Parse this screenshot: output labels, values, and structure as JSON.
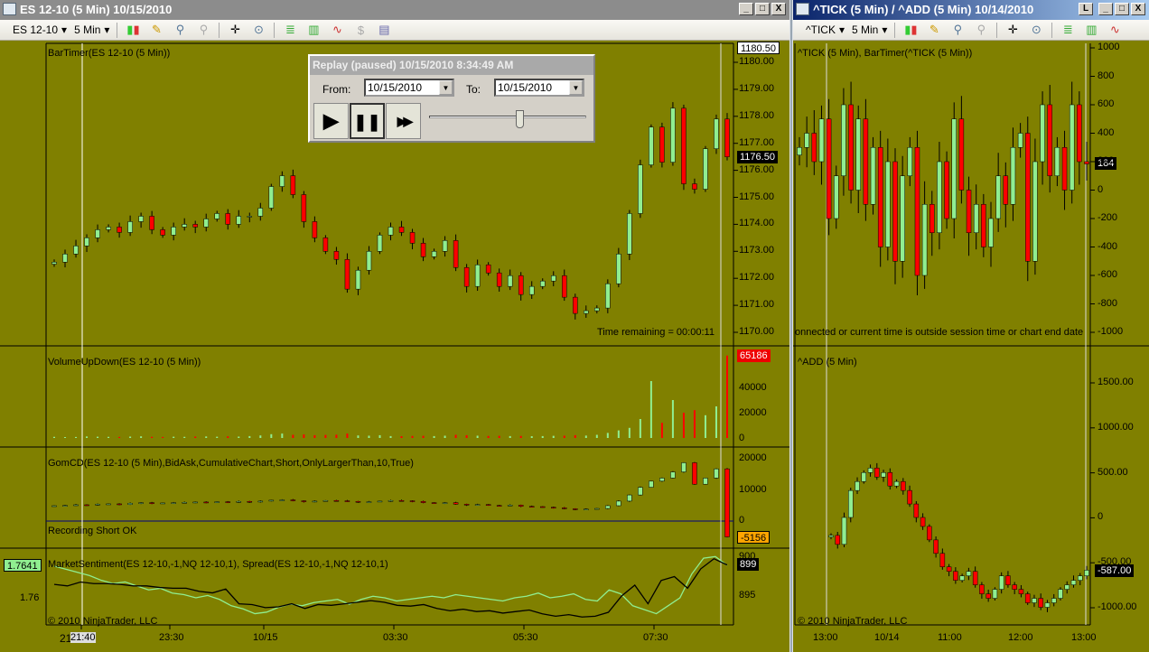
{
  "left_window": {
    "title": "ES 12-10 (5 Min)  10/15/2010",
    "toolbar": {
      "instrument": "ES 12-10",
      "interval": "5 Min"
    },
    "window_buttons": [
      "_",
      "□",
      "X"
    ],
    "panels": {
      "price": {
        "label": "BarTimer(ES 12-10 (5 Min))",
        "axis": [
          "1180.00",
          "1179.00",
          "1178.00",
          "1177.00",
          "1176.00",
          "1175.00",
          "1174.00",
          "1173.00",
          "1172.00",
          "1171.00",
          "1170.00"
        ],
        "top_tag": "1180.50",
        "last_tag": "1176.50",
        "time_remaining": "Time remaining = 00:00:11"
      },
      "volume": {
        "label": "VolumeUpDown(ES 12-10 (5 Min))",
        "axis": [
          "40000",
          "20000",
          "0"
        ],
        "last_tag": "65186"
      },
      "gomcd": {
        "label": "GomCD(ES 12-10 (5 Min),BidAsk,CumulativeChart,Short,OnlyLargerThan,10,True)",
        "axis": [
          "20000",
          "10000",
          "0"
        ],
        "status": "Recording Short OK",
        "last_tag": "-5156"
      },
      "sentiment": {
        "label": "MarketSentiment(ES 12-10,-1,NQ 12-10,1), Spread(ES 12-10,-1,NQ 12-10,1)",
        "left_axis": "1.76",
        "left_tag": "1.7641",
        "right_axis": [
          "900",
          "895"
        ],
        "right_tag": "899",
        "copyright": "© 2010 NinjaTrader, LLC"
      }
    },
    "time_axis": [
      "21:40",
      "23:30",
      "10/15",
      "03:30",
      "05:30",
      "07:30"
    ],
    "time_axis_prefix": "21"
  },
  "replay": {
    "title": "Replay (paused) 10/15/2010 8:34:49 AM",
    "from_label": "From:",
    "from_value": "10/15/2010",
    "to_label": "To:",
    "to_value": "10/15/2010",
    "play": "▶",
    "pause": "❚❚",
    "fast_forward": "▶▶",
    "slider_position": 0.55
  },
  "right_window": {
    "title": "^TICK (5 Min) / ^ADD (5 Min)  10/14/2010",
    "toolbar": {
      "instrument": "^TICK",
      "interval": "5 Min"
    },
    "window_buttons": [
      "L",
      "_",
      "□",
      "X"
    ],
    "tick": {
      "label": "^TICK (5 Min), BarTimer(^TICK (5 Min))",
      "axis": [
        "1000",
        "800",
        "600",
        "400",
        "200",
        "0",
        "-200",
        "-400",
        "-600",
        "-800",
        "-1000"
      ],
      "last_tag": "184",
      "message": "onnected or current time is outside session time or chart end date"
    },
    "add": {
      "label": "^ADD (5 Min)",
      "axis": [
        "1500.00",
        "1000.00",
        "500.00",
        "0",
        "-500.00",
        "-1000.00"
      ],
      "last_tag": "-587.00",
      "copyright": "© 2010 NinjaTrader, LLC"
    },
    "time_axis": [
      "13:00",
      "10/14",
      "11:00",
      "12:00",
      "13:00"
    ]
  },
  "colors": {
    "background": "#808000",
    "up": "#90ee90",
    "down": "#ff0000",
    "wick": "#000000"
  },
  "chart_data": [
    {
      "type": "candlestick",
      "name": "ES 12-10 (5 Min)",
      "ylim": [
        1170,
        1180.5
      ],
      "close": [
        1172.6,
        1172.9,
        1173.2,
        1173.5,
        1173.8,
        1173.9,
        1173.7,
        1174.1,
        1174.3,
        1173.8,
        1173.6,
        1173.9,
        1174.0,
        1173.9,
        1174.2,
        1174.4,
        1174.0,
        1174.3,
        1174.3,
        1174.6,
        1175.4,
        1175.8,
        1175.1,
        1174.1,
        1173.5,
        1173.0,
        1172.7,
        1171.6,
        1172.3,
        1173.0,
        1173.6,
        1173.9,
        1173.7,
        1173.3,
        1172.8,
        1173.0,
        1173.4,
        1172.4,
        1171.7,
        1172.5,
        1172.2,
        1171.7,
        1172.1,
        1171.4,
        1171.7,
        1171.9,
        1172.1,
        1171.3,
        1170.7,
        1170.8,
        1170.9,
        1171.8,
        1172.9,
        1174.4,
        1176.2,
        1177.6,
        1176.3,
        1178.3,
        1175.5,
        1175.3,
        1176.8,
        1177.9,
        1176.5
      ]
    },
    {
      "type": "bar",
      "name": "VolumeUpDown",
      "ylim": [
        0,
        65186
      ],
      "values": [
        900,
        700,
        800,
        1200,
        1000,
        900,
        800,
        1100,
        1300,
        900,
        800,
        1000,
        900,
        1100,
        1200,
        1000,
        1300,
        1100,
        1500,
        2000,
        3000,
        3500,
        2500,
        2800,
        2200,
        2400,
        2600,
        3500,
        2000,
        1800,
        2200,
        1500,
        1400,
        1600,
        1700,
        1500,
        1800,
        2500,
        2200,
        1800,
        1600,
        1700,
        1500,
        1600,
        1400,
        1500,
        1700,
        1800,
        2200,
        1900,
        2500,
        4000,
        6000,
        8000,
        15000,
        45000,
        12000,
        30000,
        20000,
        22000,
        18000,
        25000,
        65186
      ]
    },
    {
      "type": "candlestick",
      "name": "GomCD",
      "ylim": [
        -7000,
        22000
      ],
      "close": [
        5000,
        5100,
        5300,
        5200,
        5500,
        5600,
        5400,
        5800,
        6000,
        5700,
        5900,
        6000,
        6100,
        6200,
        6000,
        6300,
        6100,
        6400,
        6200,
        6500,
        6800,
        6900,
        6600,
        6300,
        6500,
        6700,
        6600,
        6400,
        6200,
        6300,
        6500,
        6700,
        6600,
        6400,
        6000,
        5800,
        6000,
        5500,
        5200,
        5400,
        5100,
        5000,
        5200,
        4800,
        4700,
        4500,
        4300,
        4000,
        3800,
        3900,
        4100,
        5000,
        6500,
        8500,
        11000,
        13000,
        14000,
        16000,
        19000,
        12000,
        14000,
        17000,
        -5156
      ]
    },
    {
      "type": "line",
      "name": "MarketSentiment",
      "ylim": [
        1.7575,
        1.7655
      ],
      "values": [
        1.764,
        1.7636,
        1.7632,
        1.7628,
        1.7622,
        1.7618,
        1.762,
        1.7615,
        1.761,
        1.7612,
        1.7606,
        1.7604,
        1.76,
        1.7603,
        1.7598,
        1.759,
        1.7586,
        1.758,
        1.7582,
        1.7588,
        1.7592,
        1.759,
        1.7594,
        1.7596,
        1.7598,
        1.7592,
        1.7598,
        1.7602,
        1.76,
        1.7596,
        1.7598,
        1.76,
        1.7602,
        1.76,
        1.7604,
        1.7602,
        1.76,
        1.7598,
        1.7596,
        1.76,
        1.7602,
        1.7606,
        1.76,
        1.7602,
        1.7605,
        1.7598,
        1.7596,
        1.761,
        1.7605,
        1.759,
        1.7585,
        1.758,
        1.759,
        1.76,
        1.763,
        1.765,
        1.7652,
        1.7641
      ]
    },
    {
      "type": "line",
      "name": "Spread",
      "ylim": [
        891,
        900.5
      ],
      "values": [
        896.5,
        896.3,
        896.8,
        896.6,
        896.6,
        896.5,
        896.3,
        896.3,
        896.1,
        896.0,
        896.0,
        895.6,
        895.4,
        895.9,
        894.0,
        893.9,
        893.5,
        893.6,
        894.0,
        893.4,
        893.9,
        893.8,
        894.0,
        894.2,
        894.4,
        894.2,
        893.8,
        893.7,
        893.9,
        893.4,
        893.1,
        893.3,
        893.0,
        893.1,
        892.8,
        893.0,
        893.2,
        892.7,
        892.4,
        892.6,
        892.3,
        892.4,
        892.9,
        895.0,
        896.4,
        894.0,
        897.0,
        897.5,
        896.0,
        898.5,
        899.8,
        899.0
      ]
    },
    {
      "type": "candlestick",
      "name": "^TICK (5 Min)",
      "ylim": [
        -1000,
        1000
      ],
      "close": [
        300,
        400,
        200,
        500,
        -200,
        100,
        600,
        0,
        500,
        -100,
        300,
        -400,
        200,
        -500,
        100,
        300,
        -600,
        -100,
        -300,
        200,
        -200,
        500,
        0,
        -300,
        -100,
        -400,
        -200,
        100,
        -100,
        300,
        400,
        -500,
        200,
        600,
        100,
        300,
        0,
        600,
        200,
        184
      ]
    },
    {
      "type": "candlestick",
      "name": "^ADD (5 Min)",
      "ylim": [
        -1000,
        1500
      ],
      "close": [
        -200,
        -300,
        0,
        300,
        400,
        500,
        550,
        450,
        500,
        350,
        400,
        300,
        150,
        0,
        -100,
        -250,
        -400,
        -550,
        -600,
        -700,
        -650,
        -600,
        -750,
        -850,
        -900,
        -800,
        -650,
        -750,
        -800,
        -850,
        -950,
        -900,
        -1000,
        -950,
        -900,
        -800,
        -750,
        -700,
        -650,
        -587
      ]
    }
  ]
}
